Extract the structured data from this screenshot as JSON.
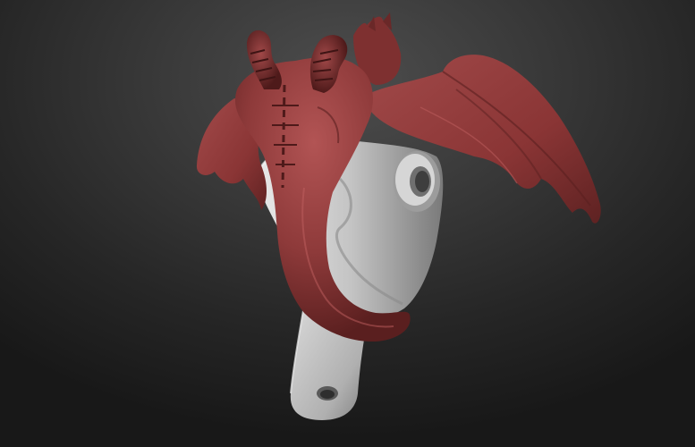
{
  "scene": {
    "background_colors": [
      "#4d4d4d",
      "#262626",
      "#181818"
    ],
    "materials": {
      "red_wax": "#8e3a3a",
      "red_wax_shadow": "#5a1f1f",
      "red_wax_highlight": "#b25454",
      "gray_clay": "#b8b8b8",
      "gray_clay_shadow": "#7a7a7a",
      "gray_clay_highlight": "#e8e8e8"
    },
    "subject": "sculpted-creature-on-mechanical-bracket"
  }
}
